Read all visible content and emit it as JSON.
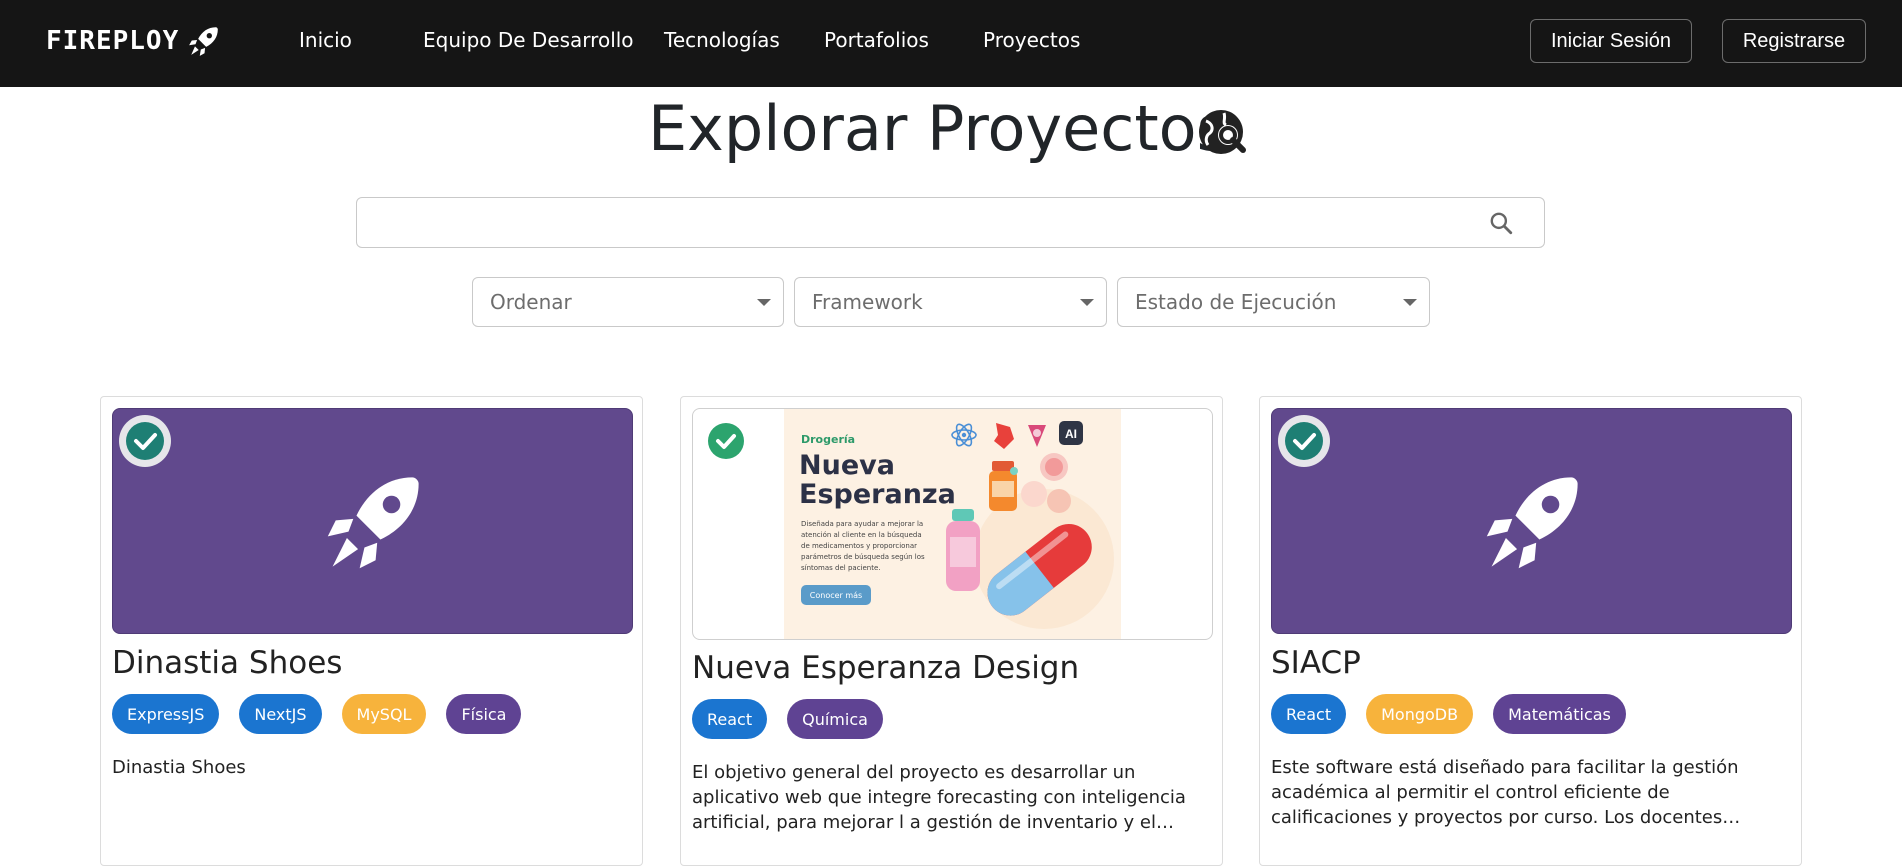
{
  "brand": {
    "name": "FIREPLOY",
    "icon": "rocket-icon"
  },
  "nav": {
    "links": [
      "Inicio",
      "Equipo De Desarrollo",
      "Tecnologías",
      "Portafolios",
      "Proyectos"
    ],
    "login": "Iniciar Sesión",
    "register": "Registrarse"
  },
  "header": {
    "title": "Explorar Proyectos",
    "icon": "globe-search-icon"
  },
  "search": {
    "placeholder": "",
    "value": "",
    "icon": "search-icon"
  },
  "filters": {
    "sort": "Ordenar",
    "framework": "Framework",
    "status": "Estado de Ejecución"
  },
  "colors": {
    "navbar": "#151515",
    "purple": "#61498d",
    "tag_blue": "#1b75d0",
    "tag_yellow": "#f7b33c",
    "tag_purple": "#5f4393",
    "check_green": "#1e7f74"
  },
  "projects": [
    {
      "title": "Dinastia Shoes",
      "tags": [
        {
          "label": "ExpressJS",
          "color": "#1b75d0"
        },
        {
          "label": "NextJS",
          "color": "#1b75d0"
        },
        {
          "label": "MySQL",
          "color": "#f7b33c"
        },
        {
          "label": "Física",
          "color": "#5f4393"
        }
      ],
      "description": "Dinastia Shoes"
    },
    {
      "title": "Nueva Esperanza Design",
      "image": {
        "kicker": "Drogería",
        "title_line1": "Nueva",
        "title_line2": "Esperanza",
        "text": "Diseñada para ayudar a mejorar la atención al cliente en la búsqueda de medicamentos y proporcionar parámetros de búsqueda según los síntomas del paciente.",
        "button": "Conocer más",
        "ai_badge": "AI"
      },
      "tags": [
        {
          "label": "React",
          "color": "#1b75d0"
        },
        {
          "label": "Química",
          "color": "#5f4393"
        }
      ],
      "description": "El objetivo general del proyecto es desarrollar un aplicativo web que integre forecasting con inteligencia artificial, para mejorar l a gestión de inventario y el registro de ventas en la \"Droguerí…"
    },
    {
      "title": "SIACP",
      "tags": [
        {
          "label": "React",
          "color": "#1b75d0"
        },
        {
          "label": "MongoDB",
          "color": "#f7b33c"
        },
        {
          "label": "Matemáticas",
          "color": "#5f4393"
        }
      ],
      "description": "Este software está diseñado para facilitar la gestión académica al permitir el control eficiente de calificaciones y proyectos por curso. Los docentes pueden registrar, editar y visualizar las n…"
    }
  ]
}
